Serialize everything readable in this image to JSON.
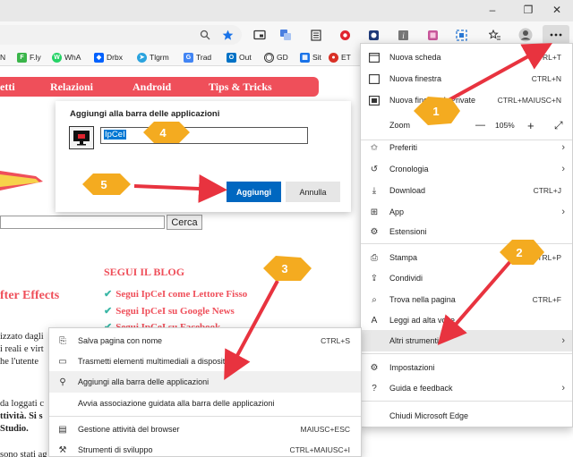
{
  "browser": {
    "window_controls": {
      "minimize": "–",
      "restore": "❐",
      "close": "✕"
    },
    "toolbar_icons": [
      "zoom-icon",
      "favorite-star-icon",
      "cast-icon",
      "translate-icon",
      "reading-view-icon",
      "record-icon",
      "extension-icon",
      "extension-icon",
      "extension-icon",
      "extension-icon",
      "collections-icon",
      "profile-icon",
      "more-icon"
    ],
    "favorites": [
      {
        "label": "N",
        "color": "#2b7de9"
      },
      {
        "label": "F.ly",
        "color": "#3ab54a"
      },
      {
        "label": "WhA",
        "color": "#25d366"
      },
      {
        "label": "Drbx",
        "color": "#0061fe"
      },
      {
        "label": "Tlgrm",
        "color": "#2aa3de"
      },
      {
        "label": "Trad",
        "color": "#4285f4"
      },
      {
        "label": "Out",
        "color": "#0072c6"
      },
      {
        "label": "GD",
        "color": "#333333"
      },
      {
        "label": "Sit",
        "color": "#1a73e8"
      },
      {
        "label": "ET",
        "color": "#d93025"
      }
    ]
  },
  "page": {
    "nav": [
      "etti",
      "Relazioni",
      "Android",
      "Tips & Tricks"
    ],
    "search_button": "Cerca",
    "segui_heading": "SEGUI IL BLOG",
    "segui_links": [
      "Segui IpCeI come Lettore Fisso",
      "Segui IpCeI su Google News",
      "Segui IpCeI su Facebook"
    ],
    "after_effects": "fter Effects",
    "body_fragments": [
      "izzato dagli",
      "i reali e virt",
      "he  l'utente",
      "da loggati c",
      "ttività. Si s",
      "Studio.",
      "sono stati ag"
    ]
  },
  "dialog": {
    "title": "Aggiungi alla barra delle applicazioni",
    "name_value": "IpCeI",
    "ok_label": "Aggiungi",
    "cancel_label": "Annulla"
  },
  "main_menu": {
    "items": [
      {
        "icon": "new-tab-icon",
        "label": "Nuova scheda",
        "shortcut": "CTRL+T"
      },
      {
        "icon": "new-window-icon",
        "label": "Nuova finestra",
        "shortcut": "CTRL+N"
      },
      {
        "icon": "inprivate-icon",
        "label": "Nuova finestra InPrivate",
        "shortcut": "CTRL+MAIUSC+N"
      },
      {
        "icon": "",
        "label": "Zoom",
        "zoom_minus": "—",
        "zoom_value": "105%",
        "zoom_plus": "+",
        "fullscreen": "⤢"
      },
      {
        "icon": "favorites-icon",
        "label": "Preferiti",
        "arrow": "›"
      },
      {
        "icon": "history-icon",
        "label": "Cronologia",
        "arrow": "›"
      },
      {
        "icon": "download-icon",
        "label": "Download",
        "shortcut": "CTRL+J"
      },
      {
        "icon": "apps-icon",
        "label": "App",
        "arrow": "›"
      },
      {
        "icon": "extensions-icon",
        "label": "Estensioni"
      },
      {
        "icon": "print-icon",
        "label": "Stampa",
        "shortcut": "CTRL+P"
      },
      {
        "icon": "share-icon",
        "label": "Condividi"
      },
      {
        "icon": "find-icon",
        "label": "Trova nella pagina",
        "shortcut": "CTRL+F"
      },
      {
        "icon": "read-aloud-icon",
        "label": "Leggi ad alta voce"
      },
      {
        "icon": "",
        "label": "Altri strumenti",
        "arrow": "›"
      },
      {
        "icon": "settings-icon",
        "label": "Impostazioni"
      },
      {
        "icon": "help-icon",
        "label": "Guida e feedback",
        "arrow": "›"
      },
      {
        "icon": "",
        "label": "Chiudi Microsoft Edge"
      }
    ]
  },
  "sub_menu": {
    "items": [
      {
        "icon": "save-page-icon",
        "label": "Salva pagina con nome",
        "shortcut": "CTRL+S"
      },
      {
        "icon": "cast-media-icon",
        "label": "Trasmetti elementi multimediali a dispositivo"
      },
      {
        "icon": "pin-icon",
        "label": "Aggiungi alla barra delle applicazioni"
      },
      {
        "icon": "",
        "label": "Avvia associazione guidata alla barra delle applicazioni"
      },
      {
        "icon": "task-manager-icon",
        "label": "Gestione attività del browser",
        "shortcut": "MAIUSC+ESC"
      },
      {
        "icon": "dev-tools-icon",
        "label": "Strumenti di sviluppo",
        "shortcut": "CTRL+MAIUSC+I"
      }
    ]
  },
  "annotations": [
    "1",
    "2",
    "3",
    "4",
    "5"
  ],
  "colors": {
    "accent_red": "#ef4f5a",
    "badge": "#f4ab20",
    "arrow": "#e8333f",
    "edge_blue": "#0067c0"
  }
}
